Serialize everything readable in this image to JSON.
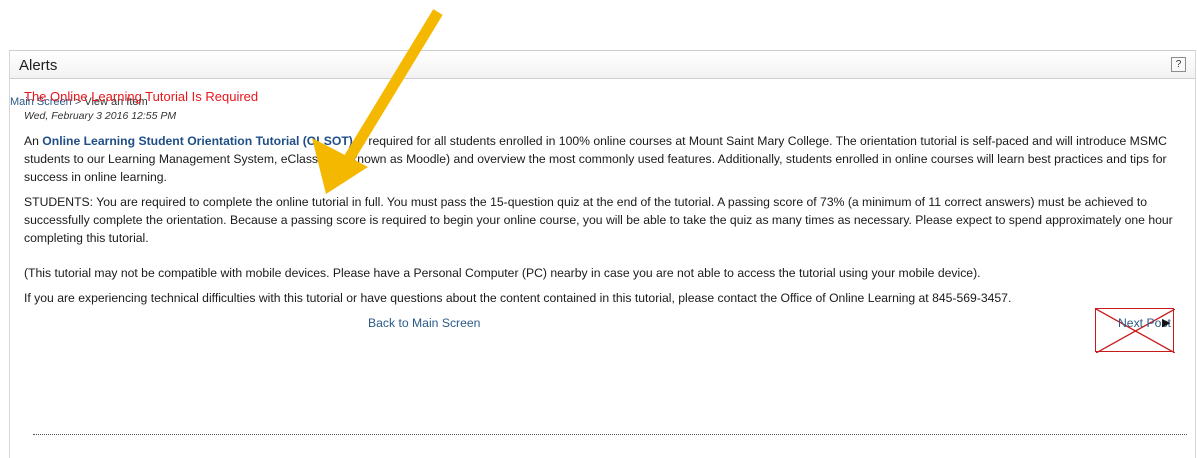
{
  "header": {
    "title": "Alerts",
    "help_label": "?"
  },
  "breadcrumb": {
    "parent": "Main Screen",
    "separator": " > ",
    "current": "View an Item"
  },
  "alert": {
    "title": "The Online Learning Tutorial Is Required",
    "date": "Wed, February 3 2016   12:55 PM",
    "para1_prefix": "An ",
    "para1_link": "Online Learning Student Orientation Tutorial (OLSOT)",
    "para1_rest": " is required for all students enrolled in 100% online courses at Mount Saint Mary College.  The orientation tutorial is self-paced and will introduce MSMC students to our Learning Management System, eClass (also known as Moodle) and overview the most commonly used features. Additionally, students enrolled in online courses will learn best practices and tips for success in online learning.",
    "para2": "STUDENTS: You are required to complete the online tutorial in full. You must pass the 15-question quiz at the end of the tutorial. A passing score of 73% (a minimum of 11 correct answers) must be achieved to successfully complete the orientation. Because a passing score is required to begin your online course, you will be able to take the quiz as many times as necessary. Please expect to spend approximately one hour completing this tutorial.",
    "para3": "(This tutorial may not be compatible with mobile devices. Please have a Personal Computer (PC) nearby in case you are not able to access the tutorial using your mobile device).",
    "para4": "If you are experiencing technical difficulties with this tutorial or have questions about the content contained in this tutorial, please contact the Office of Online Learning at 845-569-3457."
  },
  "nav": {
    "back_label": "Back to Main Screen",
    "next_label": "Next Post",
    "next_arrow": "▶"
  },
  "colors": {
    "alert_title": "#e8151b",
    "link": "#2c5a88",
    "annotation_arrow": "#f5b800",
    "cross_box": "#c81a1a"
  }
}
